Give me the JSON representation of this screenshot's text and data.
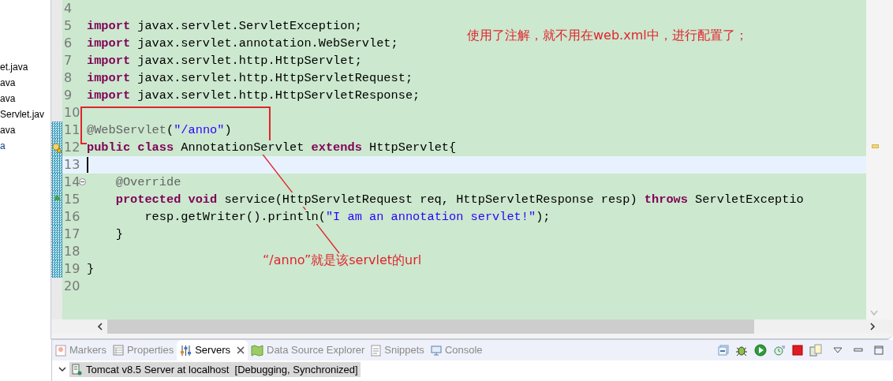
{
  "explorer": {
    "items": [
      {
        "label": "et.java",
        "selected": false
      },
      {
        "label": "ava",
        "selected": false
      },
      {
        "label": "ava",
        "selected": false
      },
      {
        "label": "Servlet.jav",
        "selected": false
      },
      {
        "label": "ava",
        "selected": false
      },
      {
        "label": "a",
        "selected": true
      }
    ]
  },
  "editor": {
    "lines": [
      {
        "number": "4",
        "current": false,
        "changed": false
      },
      {
        "number": "5",
        "current": false,
        "changed": false,
        "tokens": [
          {
            "kind": "keyword",
            "text": "import"
          },
          {
            "kind": "plain",
            "text": " javax.servlet.ServletException;"
          }
        ]
      },
      {
        "number": "6",
        "current": false,
        "changed": false,
        "tokens": [
          {
            "kind": "keyword",
            "text": "import"
          },
          {
            "kind": "plain",
            "text": " javax.servlet.annotation.WebServlet;"
          }
        ]
      },
      {
        "number": "7",
        "current": false,
        "changed": false,
        "tokens": [
          {
            "kind": "keyword",
            "text": "import"
          },
          {
            "kind": "plain",
            "text": " javax.servlet.http.HttpServlet;"
          }
        ]
      },
      {
        "number": "8",
        "current": false,
        "changed": false,
        "tokens": [
          {
            "kind": "keyword",
            "text": "import"
          },
          {
            "kind": "plain",
            "text": " javax.servlet.http.HttpServletRequest;"
          }
        ]
      },
      {
        "number": "9",
        "current": false,
        "changed": false,
        "tokens": [
          {
            "kind": "keyword",
            "text": "import"
          },
          {
            "kind": "plain",
            "text": " javax.servlet.http.HttpServletResponse;"
          }
        ]
      },
      {
        "number": "10",
        "current": false,
        "changed": false
      },
      {
        "number": "11",
        "current": false,
        "changed": true,
        "tokens": [
          {
            "kind": "annotation",
            "text": "@WebServlet"
          },
          {
            "kind": "plain",
            "text": "("
          },
          {
            "kind": "string",
            "text": "\"/anno\""
          },
          {
            "kind": "plain",
            "text": ")"
          }
        ]
      },
      {
        "number": "12",
        "current": false,
        "changed": true,
        "warning": true,
        "tokens": [
          {
            "kind": "keyword",
            "text": "public class"
          },
          {
            "kind": "plain",
            "text": " AnnotationServlet "
          },
          {
            "kind": "keyword",
            "text": "extends"
          },
          {
            "kind": "plain",
            "text": " HttpServlet{"
          }
        ]
      },
      {
        "number": "13",
        "current": true,
        "changed": true
      },
      {
        "number": "14",
        "current": false,
        "changed": true,
        "foldable": true,
        "tokens": [
          {
            "kind": "annotation",
            "text": "    @Override"
          }
        ]
      },
      {
        "number": "15",
        "current": false,
        "changed": true,
        "overrides": true,
        "tokens": [
          {
            "kind": "keyword",
            "text": "    protected void"
          },
          {
            "kind": "plain",
            "text": " service(HttpServletRequest req, HttpServletResponse resp) "
          },
          {
            "kind": "keyword",
            "text": "throws"
          },
          {
            "kind": "plain",
            "text": " ServletExceptio"
          }
        ]
      },
      {
        "number": "16",
        "current": false,
        "changed": true,
        "tokens": [
          {
            "kind": "plain",
            "text": "        resp.getWriter().println("
          },
          {
            "kind": "string",
            "text": "\"I am an annotation servlet!\""
          },
          {
            "kind": "plain",
            "text": ");"
          }
        ]
      },
      {
        "number": "17",
        "current": false,
        "changed": true,
        "tokens": [
          {
            "kind": "plain",
            "text": "    }"
          }
        ]
      },
      {
        "number": "18",
        "current": false,
        "changed": true
      },
      {
        "number": "19",
        "current": false,
        "changed": true,
        "tokens": [
          {
            "kind": "plain",
            "text": "}"
          }
        ]
      },
      {
        "number": "20",
        "current": false,
        "changed": false
      }
    ]
  },
  "notes": [
    "使用了注解，就不用在web.xml中，进行配置了；",
    "“/anno”就是该servlet的url"
  ],
  "bottom_panel": {
    "tabs": [
      {
        "label": "Markers",
        "selected": false
      },
      {
        "label": "Properties",
        "selected": false
      },
      {
        "label": "Servers",
        "selected": true
      },
      {
        "label": "Data Source Explorer",
        "selected": false
      },
      {
        "label": "Snippets",
        "selected": false
      },
      {
        "label": "Console",
        "selected": false
      }
    ],
    "servers": [
      {
        "label": "Tomcat v8.5 Server at localhost  [Debugging, Synchronized]",
        "selected": true,
        "expanded": true
      }
    ]
  }
}
